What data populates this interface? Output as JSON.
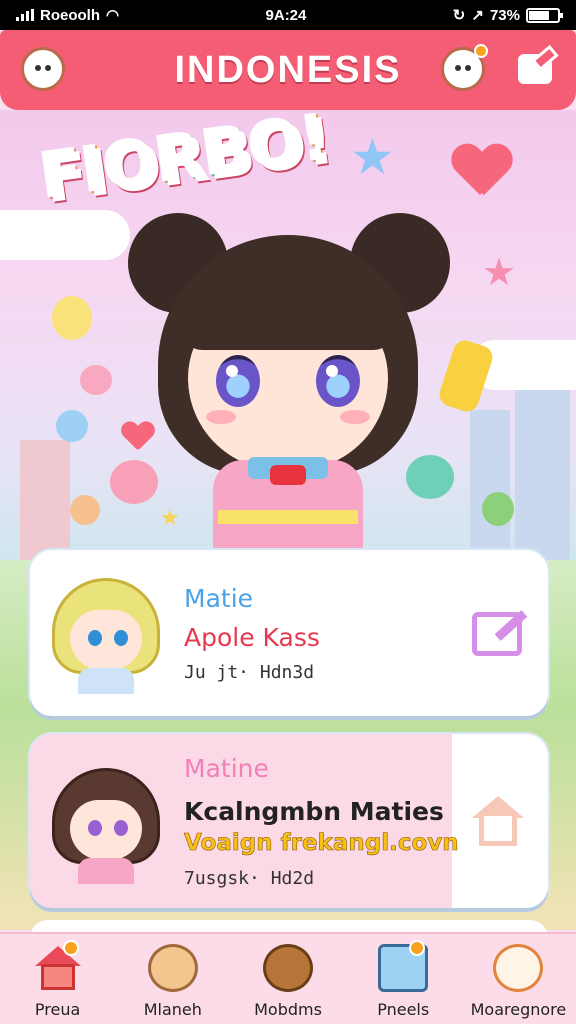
{
  "status_bar": {
    "carrier": "Roeoolh",
    "time": "9A:24",
    "battery": "73%",
    "battery_level": 0.73
  },
  "header": {
    "title": "INDONESIS",
    "left_icon": "mascot-avatar-icon",
    "notify_icon": "mascot-face-icon",
    "compose_icon": "edit-icon"
  },
  "hero": {
    "logo_text": "FIORBO!"
  },
  "cards": [
    {
      "name": "Matie",
      "subtitle": "Apole Kass",
      "meta": "Ju jt· Hdn3d",
      "action_icon": "edit-icon",
      "colors": {
        "name": "#4aa3e8",
        "subtitle": "#e8384f"
      }
    },
    {
      "name": "Matine",
      "subtitle": "Kcalngmbn Maties",
      "link": "Voaign frekangl.covn",
      "meta": "7usgsk· Hd2d",
      "action_icon": "home-icon",
      "colors": {
        "name": "#f080b8",
        "link": "#f7c01a"
      }
    }
  ],
  "nav": {
    "items": [
      {
        "label": "Preua",
        "icon": "home-icon",
        "badge": true
      },
      {
        "label": "Mlaneh",
        "icon": "character-icon",
        "badge": false
      },
      {
        "label": "Mobdms",
        "icon": "bear-icon",
        "badge": false
      },
      {
        "label": "Pneels",
        "icon": "board-icon",
        "badge": true
      },
      {
        "label": "Moaregnore",
        "icon": "puppy-icon",
        "badge": false
      }
    ]
  },
  "colors": {
    "accent": "#f45d73",
    "background": "#f8dff0",
    "nav_background": "#fcdce9"
  }
}
